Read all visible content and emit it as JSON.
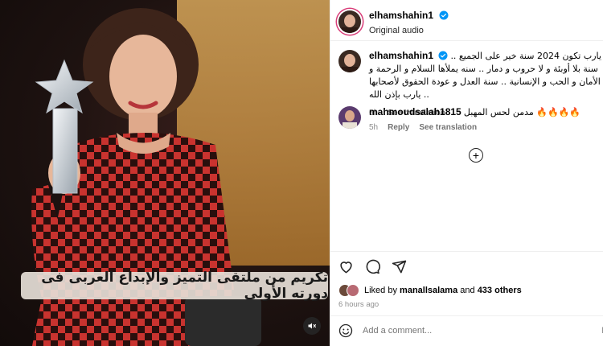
{
  "post": {
    "username": "elhamshahin1",
    "audio": "Original audio",
    "image_caption": "تكريم من ملتقى التميز والإبداع العربى فى دورته الأولى",
    "caption": {
      "username": "elhamshahin1",
      "text": "يارب تكون 2024 سنة خير على الجميع .. سنة بلا أوبئة و لا حروب و دمار .. سنه يملأها السلام و الرحمة و الأمان و الحب و الإنسانية .. سنة العدل و عودة الحقوق لأصحابها .. يارب بإذن الله",
      "age": "6h",
      "see_translation": "See translation"
    },
    "comments": [
      {
        "username": "mahmoudsalah1815",
        "text": "مدمن لحس المهبل 🔥🔥🔥🔥",
        "age": "5h",
        "reply": "Reply",
        "see_translation": "See translation"
      }
    ],
    "likes": {
      "prefix": "Liked by",
      "user": "manallsalama",
      "joiner": "and",
      "others": "433 others"
    },
    "timestamp": "6 hours ago",
    "add_comment_placeholder": "Add a comment...",
    "post_button": "P"
  },
  "icons": {
    "verified": "verified-badge-icon",
    "like": "heart-icon",
    "comment": "comment-bubble-icon",
    "share": "paper-plane-icon",
    "save": "bookmark-icon",
    "more_comments": "plus-circle-icon",
    "emoji": "smiley-icon",
    "mute": "speaker-muted-icon"
  },
  "colors": {
    "verified": "#0095f6",
    "muted_text": "#8e8e8e",
    "dress_red": "#c9332f",
    "dress_dark": "#2a0f0d",
    "sign_gold": "#d9a85b"
  }
}
